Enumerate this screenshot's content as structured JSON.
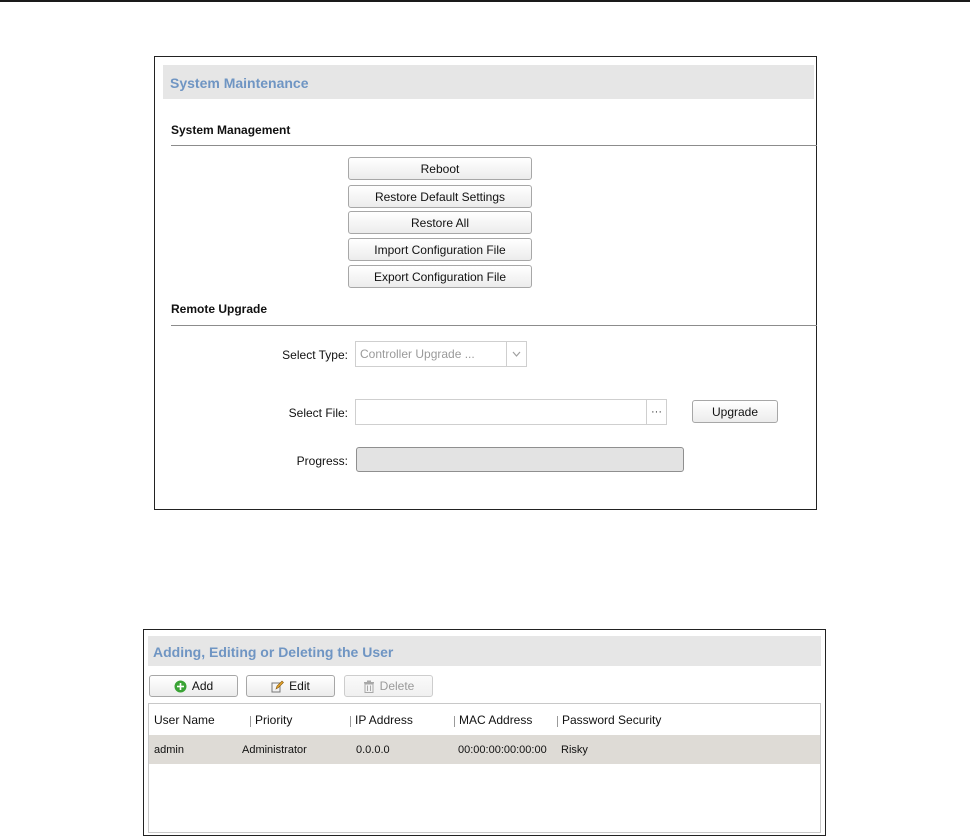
{
  "system_maintenance": {
    "title": "System Maintenance",
    "system_management": {
      "heading": "System Management",
      "buttons": [
        {
          "label": "Reboot"
        },
        {
          "label": "Restore Default Settings"
        },
        {
          "label": "Restore All"
        },
        {
          "label": "Import Configuration File"
        },
        {
          "label": "Export Configuration File"
        }
      ]
    },
    "remote_upgrade": {
      "heading": "Remote Upgrade",
      "select_type_label": "Select Type:",
      "select_type_value": "Controller Upgrade ...",
      "select_file_label": "Select File:",
      "select_file_value": "",
      "browse_label": "···",
      "upgrade_label": "Upgrade",
      "progress_label": "Progress:",
      "progress_value": 0
    }
  },
  "user_management": {
    "title": "Adding, Editing or Deleting the User",
    "toolbar": {
      "add_label": "Add",
      "edit_label": "Edit",
      "delete_label": "Delete"
    },
    "columns": [
      "User Name",
      "Priority",
      "IP Address",
      "MAC Address",
      "Password Security"
    ],
    "rows": [
      [
        "admin",
        "Administrator",
        "0.0.0.0",
        "00:00:00:00:00:00",
        "Risky"
      ]
    ]
  },
  "colors": {
    "title_blue": "#6f95c3",
    "header_gray": "#e6e6e6",
    "selected_row": "#dedbd6",
    "add_icon_green": "#3aa335"
  },
  "icons": {
    "add": "plus-circle-icon",
    "edit": "pencil-icon",
    "delete": "trash-icon",
    "browse": "ellipsis-icon",
    "select": "chevron-down-icon"
  }
}
